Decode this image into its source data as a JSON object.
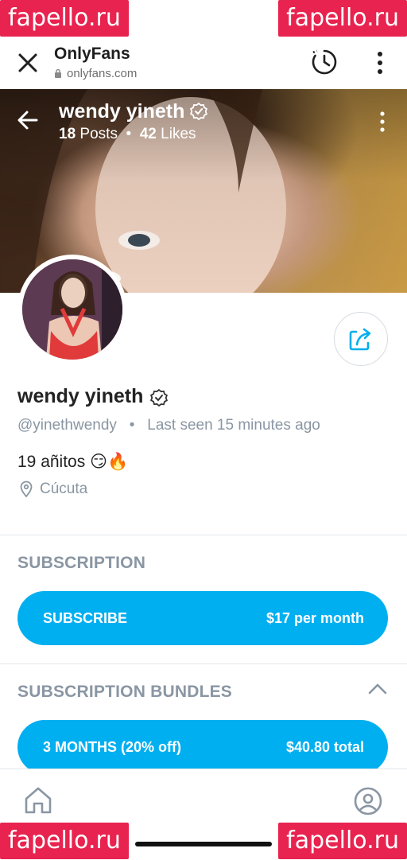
{
  "watermark": "fapello.ru",
  "browser": {
    "title": "OnlyFans",
    "url": "onlyfans.com",
    "icons": [
      "close-icon",
      "lock-icon",
      "history-icon",
      "menu-dots-icon"
    ]
  },
  "cover": {
    "name": "wendy yineth",
    "posts": "18",
    "posts_label": "Posts",
    "likes": "42",
    "likes_label": "Likes",
    "separator": "•"
  },
  "profile": {
    "name": "wendy yineth",
    "handle": "@yinethwendy",
    "separator": "•",
    "last_seen": "Last seen 15 minutes ago",
    "bio": "19 añitos 😏🔥",
    "location": "Cúcuta"
  },
  "subscription": {
    "title": "SUBSCRIPTION",
    "button_label": "SUBSCRIBE",
    "button_price": "$17 per month"
  },
  "bundles": {
    "title": "SUBSCRIPTION BUNDLES",
    "items": [
      {
        "label": "3 MONTHS (20% off)",
        "price": "$40.80 total"
      }
    ]
  },
  "colors": {
    "accent": "#00aff0",
    "watermark": "#e8234f",
    "muted_text": "#8a96a3"
  }
}
